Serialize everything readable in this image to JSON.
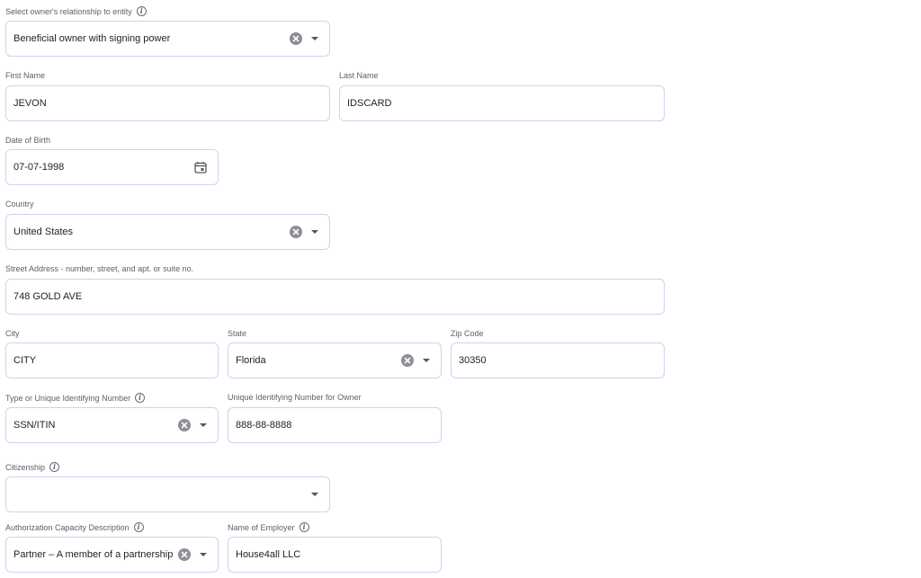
{
  "relationship": {
    "label": "Select owner's relationship to entity",
    "value": "Beneficial owner with signing power"
  },
  "first_name": {
    "label": "First Name",
    "value": "JEVON"
  },
  "last_name": {
    "label": "Last Name",
    "value": "IDSCARD"
  },
  "dob": {
    "label": "Date of Birth",
    "value": "07-07-1998"
  },
  "country": {
    "label": "Country",
    "value": "United States"
  },
  "street": {
    "label": "Street Address - number, street, and apt. or suite no.",
    "value": "748 GOLD AVE"
  },
  "city": {
    "label": "City",
    "value": "CITY"
  },
  "state": {
    "label": "State",
    "value": "Florida"
  },
  "zip": {
    "label": "Zip Code",
    "value": "30350"
  },
  "id_type": {
    "label": "Type or Unique Identifying Number",
    "value": "SSN/ITIN"
  },
  "id_number": {
    "label": "Unique Identifying Number for Owner",
    "value": "888-88-8888"
  },
  "citizenship": {
    "label": "Citizenship",
    "value": ""
  },
  "auth_capacity": {
    "label": "Authorization Capacity Description",
    "value": "Partner – A member of a partnership"
  },
  "employer": {
    "label": "Name of Employer",
    "value": "House4all LLC"
  },
  "icons": {
    "info": "info-icon",
    "clear": "clear-icon",
    "dropdown": "chevron-down-icon",
    "calendar": "calendar-icon"
  }
}
